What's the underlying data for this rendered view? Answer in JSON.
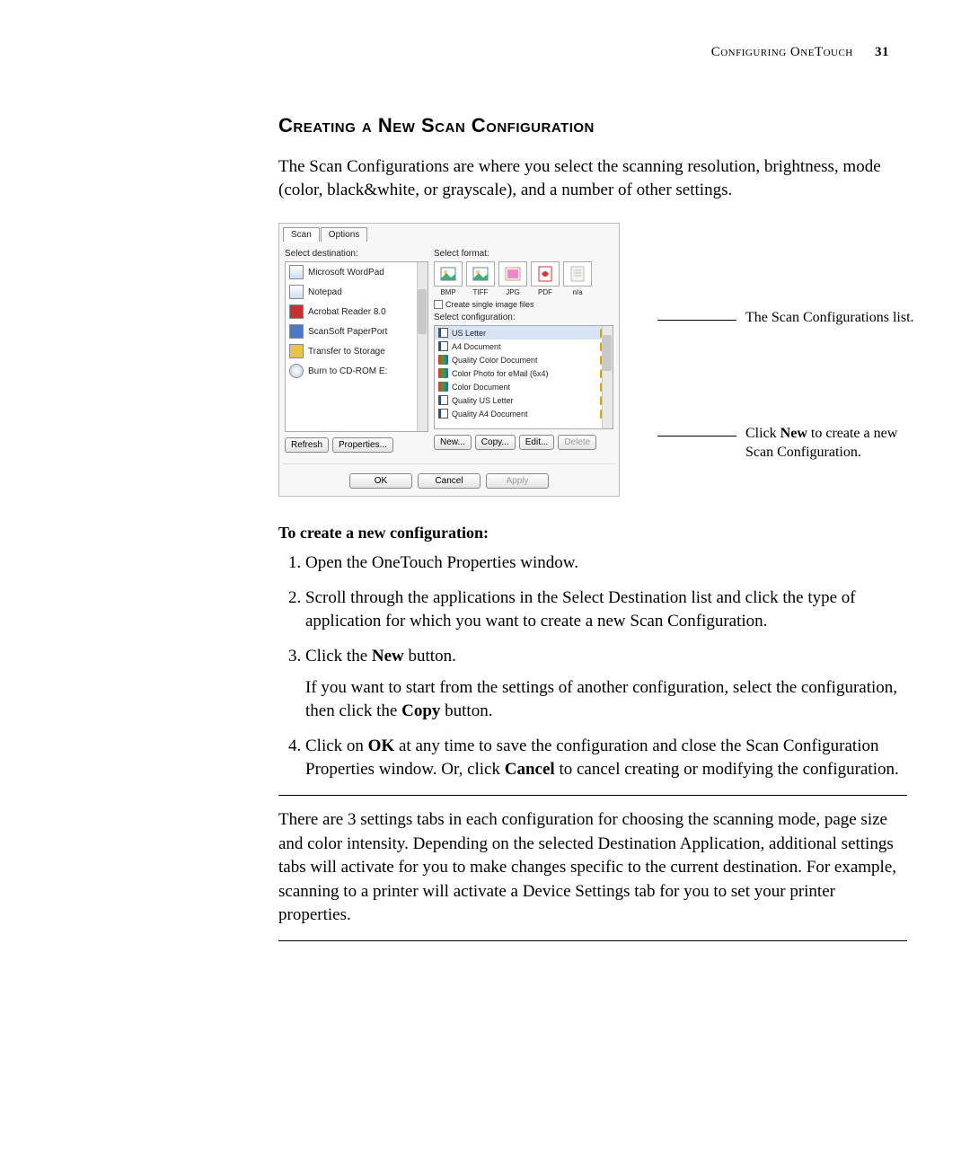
{
  "header": {
    "running": "Configuring OneTouch",
    "page": "31"
  },
  "title": "Creating a New Scan Configuration",
  "intro": "The Scan Configurations are where you select the scanning resolution, brightness, mode (color, black&white, or grayscale), and a number of other settings.",
  "dialog": {
    "tabs": {
      "scan": "Scan",
      "options": "Options"
    },
    "labels": {
      "dest": "Select destination:",
      "format": "Select format:",
      "single": "Create single image files",
      "config": "Select configuration:"
    },
    "formats": {
      "bmp": "BMP",
      "tiff": "TIFF",
      "jpg": "JPG",
      "pdf": "PDF",
      "na": "n/a"
    },
    "destinations": [
      "Microsoft WordPad",
      "Notepad",
      "Acrobat Reader 8.0",
      "ScanSoft PaperPort",
      "Transfer to Storage",
      "Burn to CD-ROM  E:"
    ],
    "configs": [
      "US Letter",
      "A4 Document",
      "Quality Color Document",
      "Color Photo for eMail (6x4)",
      "Color Document",
      "Quality US Letter",
      "Quality A4 Document"
    ],
    "buttons": {
      "refresh": "Refresh",
      "properties": "Properties...",
      "new": "New...",
      "copy": "Copy...",
      "edit": "Edit...",
      "delete": "Delete",
      "ok": "OK",
      "cancel": "Cancel",
      "apply": "Apply"
    }
  },
  "callouts": {
    "list": "The Scan Configurations list.",
    "new_a": "Click ",
    "new_b": "New",
    "new_c": " to create a new Scan Configuration."
  },
  "subhead": "To create a new configuration:",
  "steps": {
    "s1": "Open the OneTouch Properties window.",
    "s2": "Scroll through the applications in the Select Destination list and click the type of application for which you want to create a new Scan Configuration.",
    "s3a": "Click the ",
    "s3b": "New",
    "s3c": " button.",
    "s3p": "If you want to start from the settings of another configuration, select the configuration, then click the ",
    "s3p_b": "Copy",
    "s3p_c": " button.",
    "s4a": "Click on ",
    "s4b": "OK",
    "s4c": " at any time to save the configuration and close the Scan Configuration Properties window. Or, click ",
    "s4d": "Cancel",
    "s4e": " to cancel creating or modifying the configuration."
  },
  "closing": "There are 3 settings tabs in each configuration for choosing the scanning mode, page size and color intensity. Depending on the selected Destination Application, additional settings tabs will activate for you to make changes specific to the current destination. For example, scanning to a printer will activate a Device Settings tab for you to set your printer properties."
}
